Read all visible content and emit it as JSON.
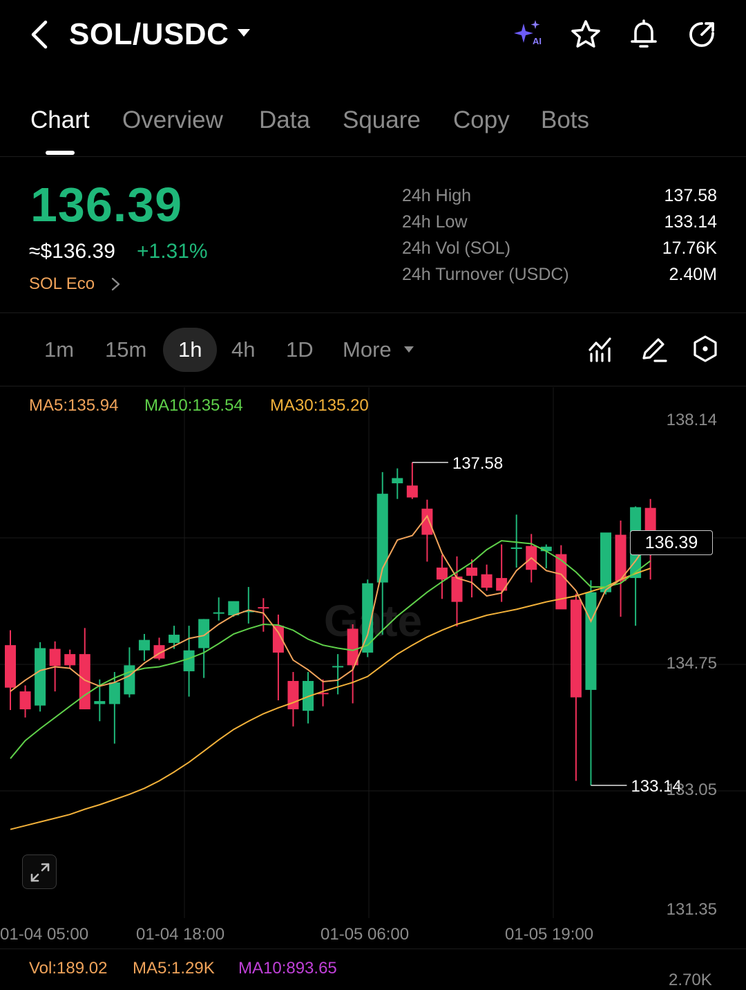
{
  "header": {
    "pair": "SOL/USDC",
    "icons": [
      "back-icon",
      "ai-sparkle-icon",
      "star-icon",
      "bell-icon",
      "share-icon"
    ],
    "ai_badge": "AI"
  },
  "tabs": [
    {
      "label": "Chart",
      "active": true
    },
    {
      "label": "Overview",
      "active": false
    },
    {
      "label": "Data",
      "active": false
    },
    {
      "label": "Square",
      "active": false
    },
    {
      "label": "Copy",
      "active": false
    },
    {
      "label": "Bots",
      "active": false
    }
  ],
  "price": {
    "last": "136.39",
    "usd": "≈$136.39",
    "change": "+1.31%",
    "eco": "SOL Eco"
  },
  "stats": [
    {
      "label": "24h  High",
      "value": "137.58"
    },
    {
      "label": "24h  Low",
      "value": "133.14"
    },
    {
      "label": "24h  Vol (SOL)",
      "value": "17.76K"
    },
    {
      "label": "24h  Turnover (USDC)",
      "value": "2.40M"
    }
  ],
  "intervals": [
    {
      "label": "1m",
      "active": false
    },
    {
      "label": "15m",
      "active": false
    },
    {
      "label": "1h",
      "active": true
    },
    {
      "label": "4h",
      "active": false
    },
    {
      "label": "1D",
      "active": false
    },
    {
      "label": "More",
      "active": false
    }
  ],
  "tools": [
    "indicators-icon",
    "draw-icon",
    "settings-hex-icon"
  ],
  "ma_legend": {
    "ma5": "MA5:135.94",
    "ma10": "MA10:135.54",
    "ma30": "MA30:135.20"
  },
  "colors": {
    "up": "#1fb87a",
    "down": "#f0305a",
    "ma5": "#f0a35a",
    "ma10": "#5fd04a",
    "ma30": "#f2b13a",
    "vol_ma10": "#c040d8"
  },
  "chart_data": {
    "type": "candlestick",
    "y_ticks": [
      "138.14",
      "134.75",
      "133.05",
      "131.35"
    ],
    "x_ticks": [
      "01-04 05:00",
      "01-04 18:00",
      "01-05 06:00",
      "01-05 19:00"
    ],
    "ylim": [
      131.35,
      138.14
    ],
    "high_marker": "137.58",
    "low_marker": "133.14",
    "current_price_tag": "136.39",
    "grid": true,
    "candles": [
      {
        "o": 135.02,
        "h": 135.22,
        "l": 134.15,
        "c": 134.45
      },
      {
        "o": 134.4,
        "h": 134.48,
        "l": 134.05,
        "c": 134.16
      },
      {
        "o": 134.21,
        "h": 135.06,
        "l": 134.13,
        "c": 134.98
      },
      {
        "o": 134.97,
        "h": 135.07,
        "l": 134.4,
        "c": 134.74
      },
      {
        "o": 134.9,
        "h": 134.96,
        "l": 134.71,
        "c": 134.75
      },
      {
        "o": 134.9,
        "h": 135.25,
        "l": 134.16,
        "c": 134.16
      },
      {
        "o": 134.23,
        "h": 134.56,
        "l": 134.0,
        "c": 134.27
      },
      {
        "o": 134.23,
        "h": 134.66,
        "l": 133.7,
        "c": 134.52
      },
      {
        "o": 134.36,
        "h": 134.99,
        "l": 134.32,
        "c": 134.75
      },
      {
        "o": 134.95,
        "h": 135.17,
        "l": 134.81,
        "c": 135.09
      },
      {
        "o": 135.02,
        "h": 135.12,
        "l": 134.82,
        "c": 134.84
      },
      {
        "o": 135.05,
        "h": 135.28,
        "l": 134.97,
        "c": 135.16
      },
      {
        "o": 134.67,
        "h": 135.28,
        "l": 134.33,
        "c": 134.95
      },
      {
        "o": 134.98,
        "h": 135.37,
        "l": 134.58,
        "c": 135.37
      },
      {
        "o": 135.46,
        "h": 135.66,
        "l": 135.35,
        "c": 135.46
      },
      {
        "o": 135.42,
        "h": 135.61,
        "l": 135.4,
        "c": 135.61
      },
      {
        "o": 135.48,
        "h": 135.8,
        "l": 135.31,
        "c": 135.48
      },
      {
        "o": 135.53,
        "h": 135.65,
        "l": 135.2,
        "c": 135.52
      },
      {
        "o": 135.28,
        "h": 135.43,
        "l": 134.28,
        "c": 134.92
      },
      {
        "o": 134.54,
        "h": 134.66,
        "l": 133.93,
        "c": 134.16
      },
      {
        "o": 134.14,
        "h": 134.66,
        "l": 133.97,
        "c": 134.54
      },
      {
        "o": 134.38,
        "h": 134.56,
        "l": 134.2,
        "c": 134.37
      },
      {
        "o": 134.74,
        "h": 134.9,
        "l": 134.36,
        "c": 134.74
      },
      {
        "o": 135.24,
        "h": 135.3,
        "l": 134.24,
        "c": 134.75
      },
      {
        "o": 134.92,
        "h": 135.9,
        "l": 134.86,
        "c": 135.85
      },
      {
        "o": 135.86,
        "h": 137.34,
        "l": 135.16,
        "c": 137.05
      },
      {
        "o": 137.19,
        "h": 137.39,
        "l": 136.98,
        "c": 137.26
      },
      {
        "o": 137.16,
        "h": 137.47,
        "l": 136.98,
        "c": 137.0
      },
      {
        "o": 136.85,
        "h": 136.97,
        "l": 136.14,
        "c": 136.5
      },
      {
        "o": 136.06,
        "h": 136.23,
        "l": 135.64,
        "c": 135.9
      },
      {
        "o": 135.94,
        "h": 136.21,
        "l": 135.27,
        "c": 135.6
      },
      {
        "o": 136.06,
        "h": 136.17,
        "l": 135.66,
        "c": 135.95
      },
      {
        "o": 135.97,
        "h": 136.1,
        "l": 135.75,
        "c": 135.79
      },
      {
        "o": 135.92,
        "h": 136.37,
        "l": 135.6,
        "c": 135.75
      },
      {
        "o": 136.31,
        "h": 136.77,
        "l": 136.06,
        "c": 136.33
      },
      {
        "o": 136.35,
        "h": 136.51,
        "l": 135.86,
        "c": 136.03
      },
      {
        "o": 136.28,
        "h": 136.37,
        "l": 136.05,
        "c": 136.34
      },
      {
        "o": 136.24,
        "h": 136.36,
        "l": 135.75,
        "c": 135.5
      },
      {
        "o": 135.63,
        "h": 135.71,
        "l": 133.2,
        "c": 134.32
      },
      {
        "o": 134.42,
        "h": 135.89,
        "l": 133.14,
        "c": 135.73
      },
      {
        "o": 135.73,
        "h": 136.48,
        "l": 135.7,
        "c": 136.53
      },
      {
        "o": 136.5,
        "h": 136.69,
        "l": 135.4,
        "c": 135.88
      },
      {
        "o": 135.92,
        "h": 136.88,
        "l": 135.28,
        "c": 136.87
      },
      {
        "o": 136.86,
        "h": 136.98,
        "l": 135.9,
        "c": 136.39
      }
    ],
    "ma5": [
      134.4,
      134.55,
      134.68,
      134.73,
      134.71,
      134.55,
      134.47,
      134.52,
      134.61,
      134.78,
      134.91,
      135.01,
      135.11,
      135.15,
      135.3,
      135.42,
      135.49,
      135.45,
      135.19,
      134.82,
      134.69,
      134.53,
      134.55,
      134.69,
      135.16,
      136.05,
      136.43,
      136.49,
      136.75,
      136.25,
      135.92,
      135.86,
      135.68,
      135.72,
      136.02,
      136.19,
      136.02,
      135.97,
      135.75,
      135.34,
      135.76,
      135.9,
      136.15,
      136.44
    ],
    "ma10": [
      133.5,
      133.74,
      133.9,
      134.05,
      134.2,
      134.35,
      134.48,
      134.58,
      134.66,
      134.71,
      134.73,
      134.78,
      134.84,
      134.92,
      135.04,
      135.17,
      135.24,
      135.3,
      135.29,
      135.22,
      135.1,
      135.02,
      134.98,
      134.95,
      135.02,
      135.22,
      135.41,
      135.57,
      135.73,
      135.87,
      136.0,
      136.13,
      136.3,
      136.42,
      136.4,
      136.38,
      136.28,
      136.16,
      136.0,
      135.8,
      135.8,
      135.85,
      136.0,
      136.15
    ],
    "ma30": [
      132.55,
      132.6,
      132.65,
      132.7,
      132.75,
      132.82,
      132.88,
      132.95,
      133.02,
      133.1,
      133.2,
      133.32,
      133.45,
      133.6,
      133.75,
      133.89,
      134.0,
      134.1,
      134.18,
      134.25,
      134.33,
      134.4,
      134.46,
      134.52,
      134.6,
      134.75,
      134.9,
      135.02,
      135.13,
      135.22,
      135.3,
      135.36,
      135.42,
      135.46,
      135.5,
      135.55,
      135.6,
      135.64,
      135.68,
      135.74,
      135.8,
      135.9,
      135.98,
      136.05
    ]
  },
  "volume_legend": {
    "vol": "Vol:189.02",
    "ma5": "MA5:1.29K",
    "ma10": "MA10:893.65",
    "axis_label": "2.70K"
  }
}
